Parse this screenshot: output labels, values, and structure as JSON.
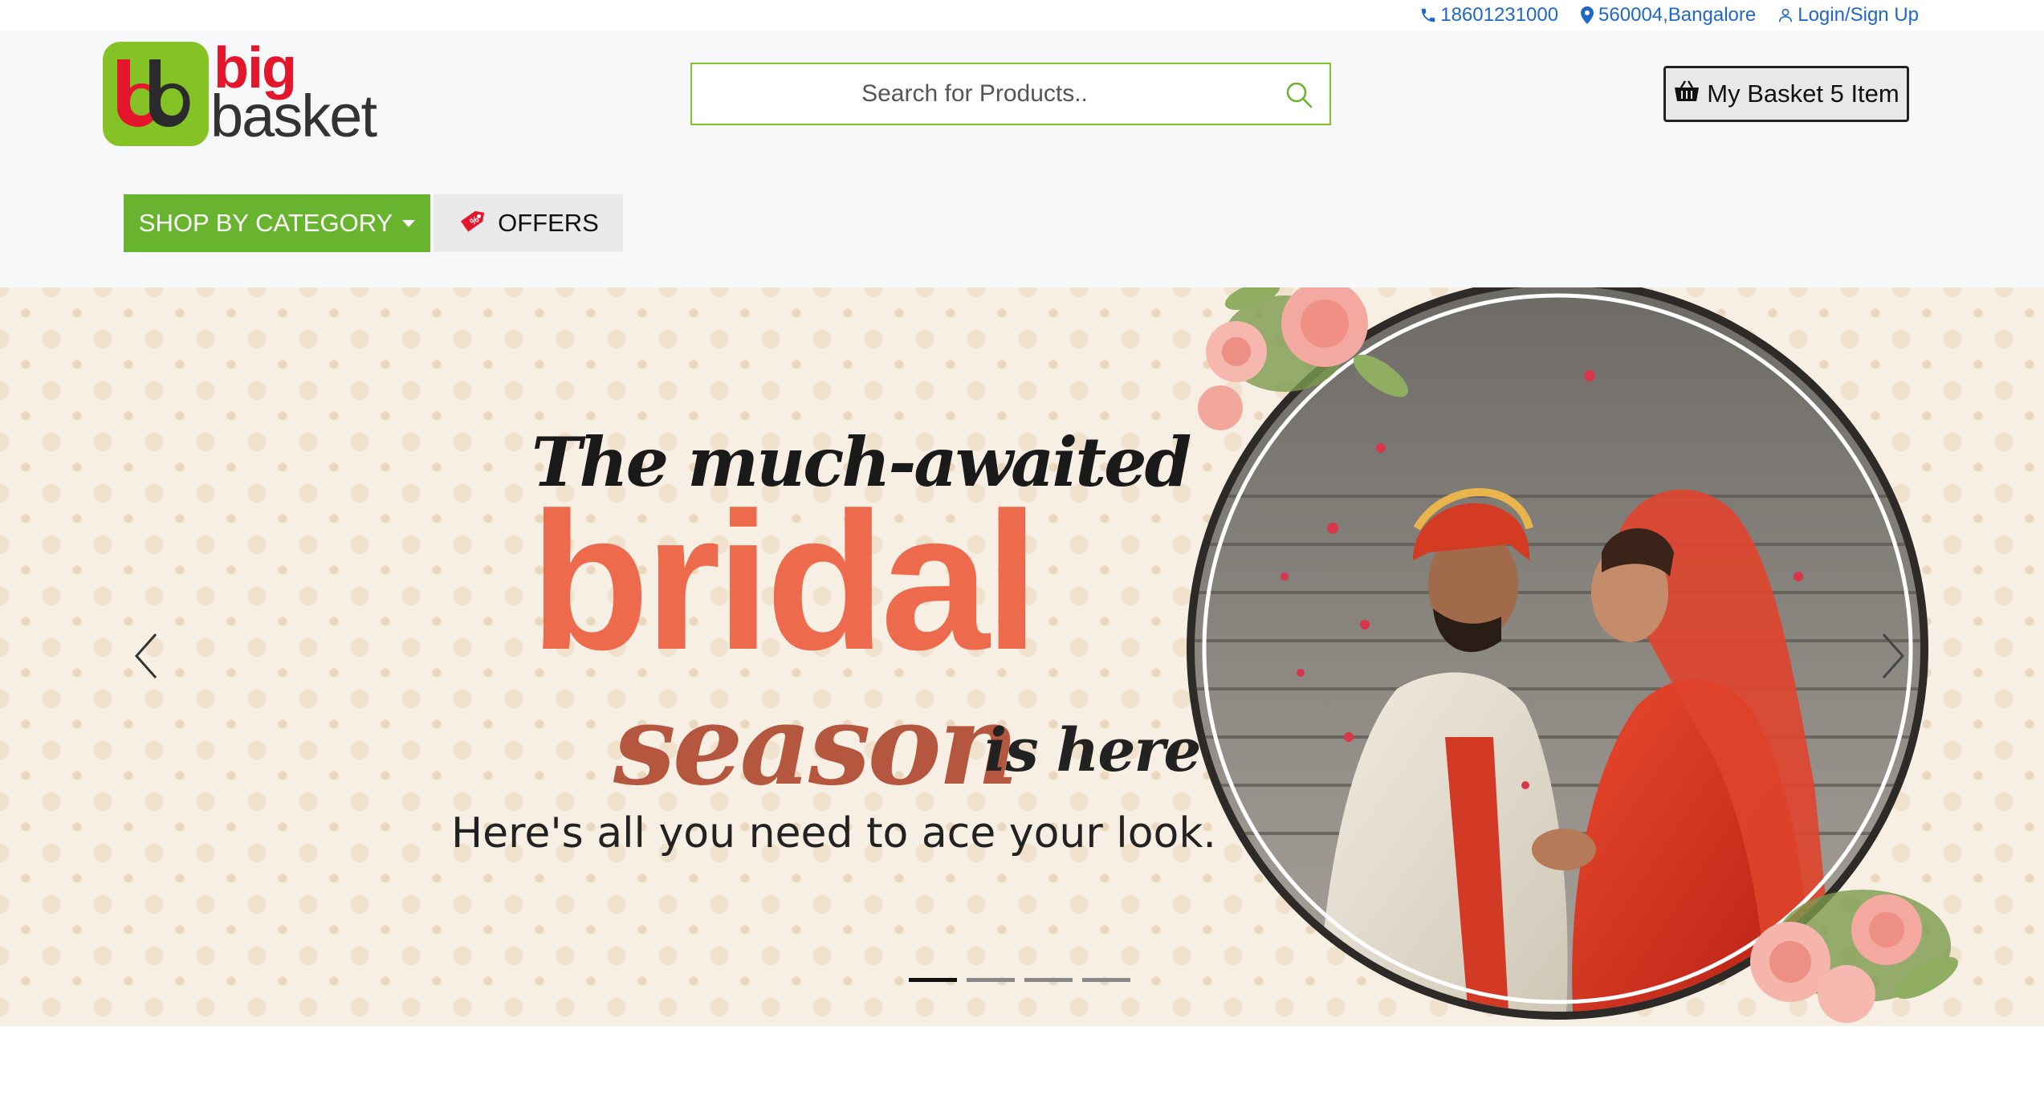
{
  "topbar": {
    "phone": "18601231000",
    "location": "560004,Bangalore",
    "login": "Login/Sign Up"
  },
  "header": {
    "logo_big": "big",
    "logo_basket": "basket",
    "search_placeholder": "Search for Products..",
    "basket_label": "My Basket 5 Item",
    "category_label": "SHOP BY CATEGORY",
    "offers_label": "OFFERS"
  },
  "banner": {
    "line1": "The much-awaited",
    "line2": "bridal",
    "line3": "season",
    "line3b": "is here",
    "line4": "Here's all you need to ace your look.",
    "slides": 4,
    "active_slide": 1
  },
  "colors": {
    "brand_green": "#84c225",
    "brand_red": "#e4162c",
    "link_blue": "#1f68c8",
    "banner_orange": "#ee6a4c"
  },
  "icons": [
    "phone-icon",
    "location-pin-icon",
    "user-icon",
    "search-icon",
    "basket-icon",
    "offer-tag-icon",
    "chevron-left-icon",
    "chevron-right-icon"
  ]
}
